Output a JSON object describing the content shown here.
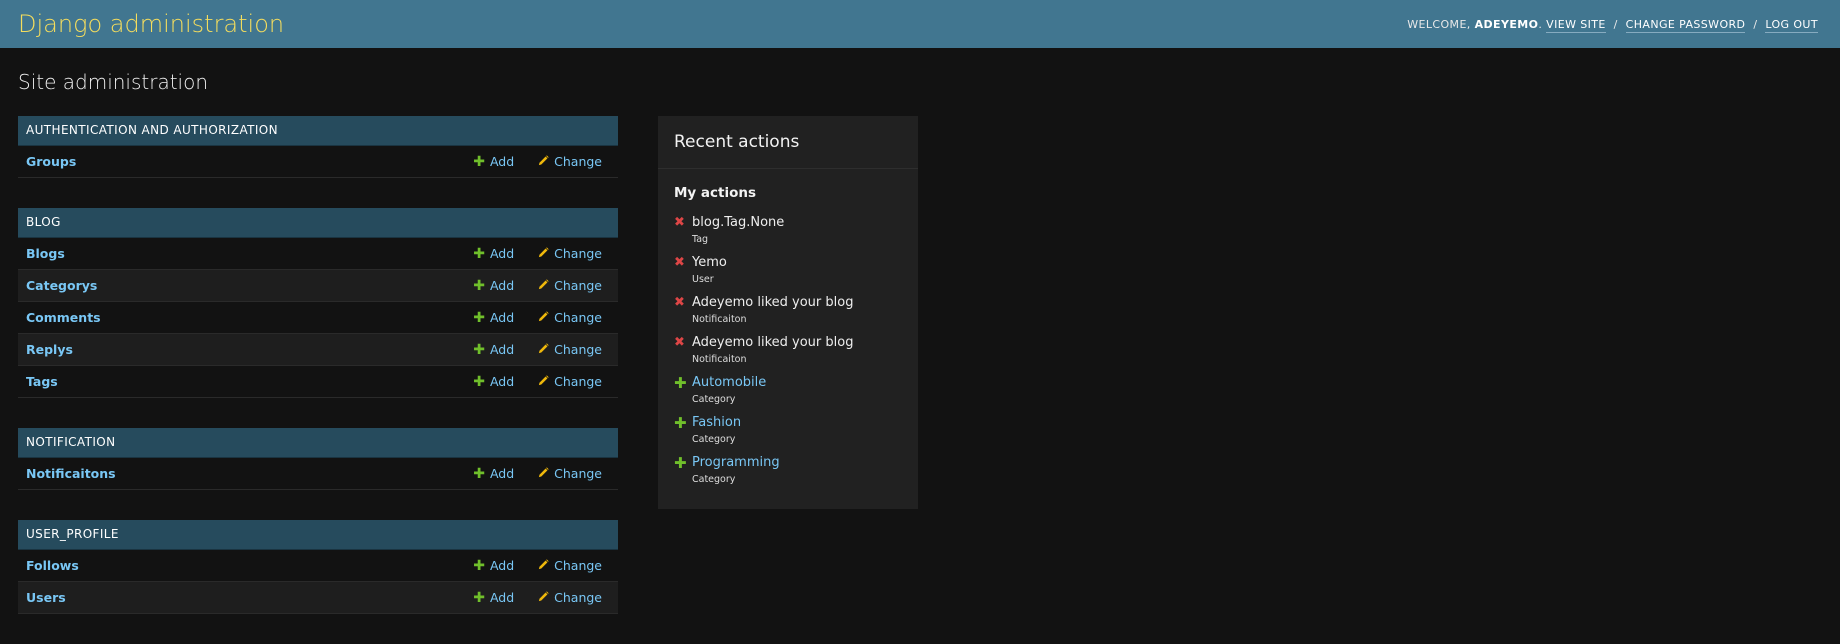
{
  "header": {
    "branding": "Django administration",
    "welcome_label": "WELCOME,",
    "username": "ADEYEMO",
    "view_site": "VIEW SITE",
    "change_password": "CHANGE PASSWORD",
    "log_out": "LOG OUT",
    "separator": "/"
  },
  "page_title": "Site administration",
  "actions": {
    "add_label": "Add",
    "change_label": "Change"
  },
  "apps": [
    {
      "caption": "AUTHENTICATION AND AUTHORIZATION",
      "models": [
        "Groups"
      ]
    },
    {
      "caption": "BLOG",
      "models": [
        "Blogs",
        "Categorys",
        "Comments",
        "Replys",
        "Tags"
      ]
    },
    {
      "caption": "NOTIFICATION",
      "models": [
        "Notificaitons"
      ]
    },
    {
      "caption": "USER_PROFILE",
      "models": [
        "Follows",
        "Users"
      ]
    }
  ],
  "recent": {
    "title": "Recent actions",
    "my_actions": "My actions",
    "items": [
      {
        "kind": "delete",
        "title": "blog.Tag.None",
        "type": "Tag"
      },
      {
        "kind": "delete",
        "title": "Yemo",
        "type": "User"
      },
      {
        "kind": "delete",
        "title": "Adeyemo liked your blog",
        "type": "Notificaiton"
      },
      {
        "kind": "delete",
        "title": "Adeyemo liked your blog",
        "type": "Notificaiton"
      },
      {
        "kind": "add",
        "title": "Automobile",
        "type": "Category"
      },
      {
        "kind": "add",
        "title": "Fashion",
        "type": "Category"
      },
      {
        "kind": "add",
        "title": "Programming",
        "type": "Category"
      }
    ]
  },
  "colors": {
    "header_bg": "#417690",
    "branding": "#f5dd5d",
    "caption_bg": "#264b5d",
    "link": "#79c7f5",
    "add_icon": "#70bf2b",
    "change_icon": "#efb80b",
    "delete_icon": "#dd4646",
    "page_bg": "#121212"
  },
  "icons": {
    "add": "plus-icon",
    "change": "pencil-icon",
    "delete": "delete-icon"
  }
}
